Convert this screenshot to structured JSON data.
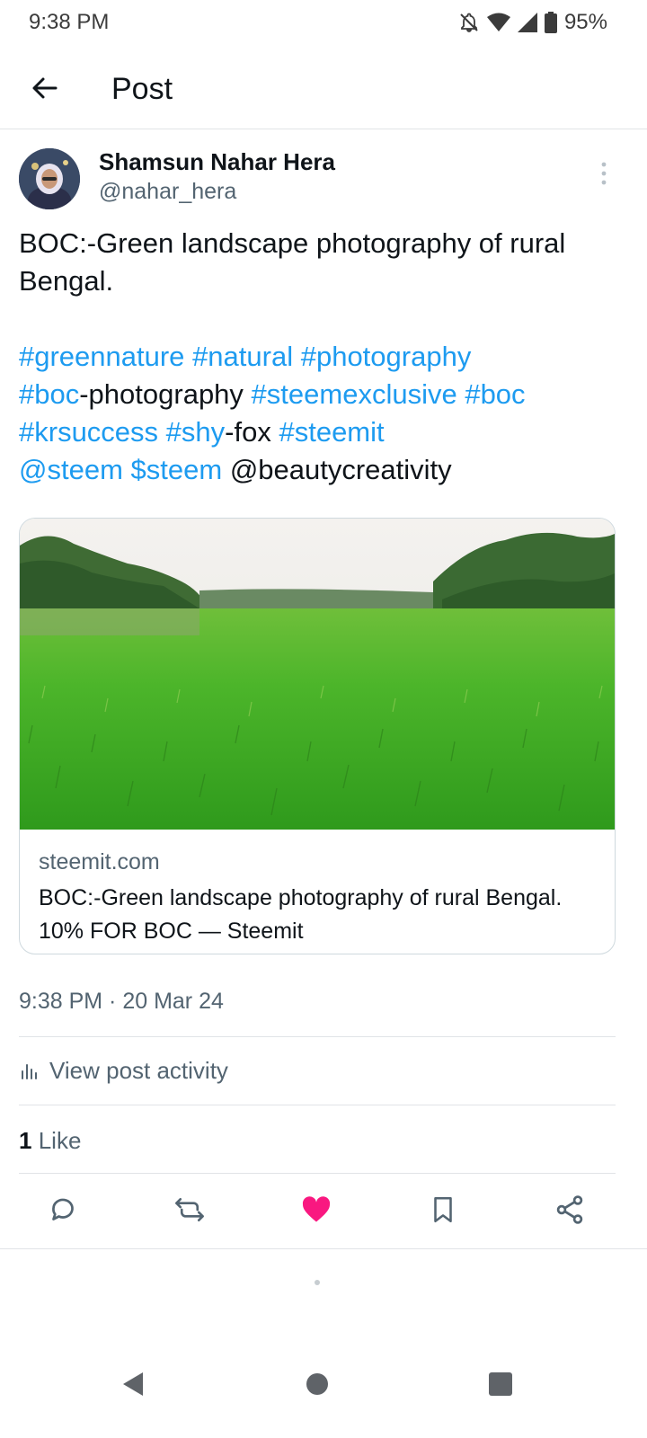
{
  "status_bar": {
    "time": "9:38 PM",
    "battery": "95%",
    "icons": [
      "bell-off-icon",
      "wifi-icon",
      "signal-icon",
      "battery-icon"
    ]
  },
  "header": {
    "title": "Post",
    "back_icon": "arrow-left-icon"
  },
  "author": {
    "name": "Shamsun Nahar Hera",
    "handle": "@nahar_hera"
  },
  "post": {
    "text_line1": "BOC:-Green landscape photography of rural",
    "text_line2": "Bengal.",
    "tags": {
      "greennature": "#greennature",
      "natural": "#natural",
      "photography": "#photography",
      "boc1": "#boc",
      "boc1_suffix": "-photography",
      "steemexclusive": "#steemexclusive",
      "boc2": "#boc",
      "krsuccess": "#krsuccess",
      "shy": "#shy",
      "shy_suffix": "-fox",
      "steemit": "#steemit",
      "steem_mention": "@steem",
      "steem_cashtag": "$steem",
      "beautycreativity": "@beautycreativity"
    }
  },
  "card": {
    "domain": "steemit.com",
    "title": "BOC:-Green landscape photography of rural Bengal. 10% FOR BOC — Steemit"
  },
  "meta": {
    "timestamp": "9:38 PM · 20 Mar 24",
    "view_activity": "View post activity",
    "like_count": "1",
    "like_label": "Like"
  },
  "actions": [
    "reply-icon",
    "retweet-icon",
    "like-icon",
    "bookmark-icon",
    "share-icon"
  ],
  "colors": {
    "link": "#1d9bf0",
    "like_active": "#f91880",
    "secondary_text": "#536471",
    "primary_text": "#0f1419"
  }
}
